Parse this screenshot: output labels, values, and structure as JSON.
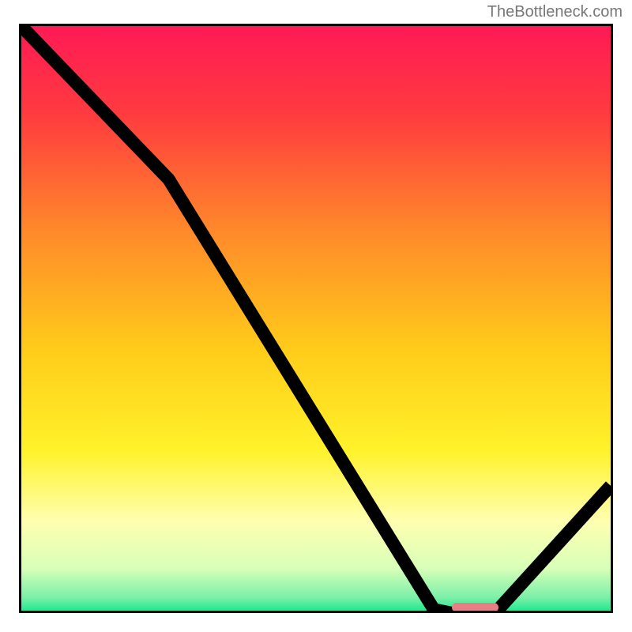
{
  "attribution": "TheBottleneck.com",
  "colors": {
    "border": "#000000",
    "curve": "#000000",
    "marker": "#e77f84",
    "gradient_stops": [
      {
        "offset": 0.0,
        "color": "#ff1a55"
      },
      {
        "offset": 0.15,
        "color": "#ff3b3f"
      },
      {
        "offset": 0.35,
        "color": "#ff8a2a"
      },
      {
        "offset": 0.55,
        "color": "#ffcc1a"
      },
      {
        "offset": 0.72,
        "color": "#fff22a"
      },
      {
        "offset": 0.84,
        "color": "#ffffb0"
      },
      {
        "offset": 0.92,
        "color": "#d8ffb8"
      },
      {
        "offset": 0.97,
        "color": "#7af0a8"
      },
      {
        "offset": 1.0,
        "color": "#00e58a"
      }
    ]
  },
  "chart_data": {
    "type": "line",
    "title": "",
    "xlabel": "",
    "ylabel": "",
    "xlim": [
      0,
      100
    ],
    "ylim": [
      0,
      100
    ],
    "grid": false,
    "series": [
      {
        "name": "curve",
        "x": [
          0,
          25,
          70,
          75,
          80,
          100
        ],
        "values": [
          100,
          74,
          1,
          0,
          0,
          22
        ]
      }
    ],
    "annotations": [
      {
        "name": "optimal-marker",
        "x_range": [
          73,
          81
        ],
        "y": 0.5
      }
    ]
  }
}
